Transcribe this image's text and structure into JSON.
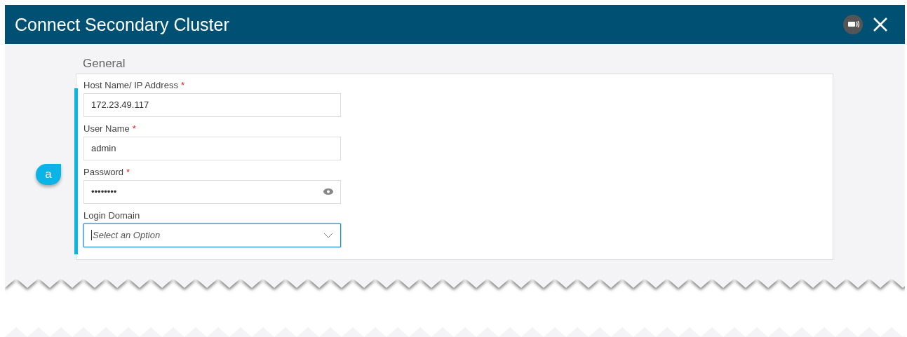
{
  "window": {
    "title": "Connect Secondary Cluster"
  },
  "section": {
    "title": "General"
  },
  "fields": [
    {
      "kind": "text",
      "label": "Host Name/ IP Address",
      "required_mark": "*",
      "value": "172.23.49.117"
    },
    {
      "kind": "text",
      "label": "User Name",
      "required_mark": "*",
      "value": "admin"
    },
    {
      "kind": "password",
      "label": "Password",
      "required_mark": "*",
      "value": "••••••••"
    },
    {
      "kind": "select",
      "label": "Login Domain",
      "placeholder": "Select an Option",
      "focused": true
    }
  ],
  "callout": {
    "label": "a"
  }
}
